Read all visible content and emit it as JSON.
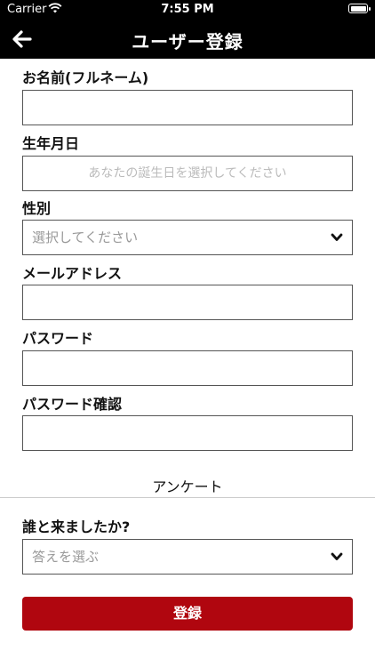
{
  "status_bar": {
    "carrier": "Carrier",
    "time": "7:55 PM"
  },
  "nav": {
    "title": "ユーザー登録",
    "back_icon": "arrow-left-icon"
  },
  "form": {
    "full_name": {
      "label": "お名前(フルネーム)",
      "value": ""
    },
    "birthday": {
      "label": "生年月日",
      "placeholder": "あなたの誕生日を選択してください"
    },
    "gender": {
      "label": "性別",
      "selected": "選択してください"
    },
    "email": {
      "label": "メールアドレス",
      "value": ""
    },
    "password": {
      "label": "パスワード",
      "value": ""
    },
    "password_confirm": {
      "label": "パスワード確認",
      "value": ""
    }
  },
  "survey": {
    "title": "アンケート",
    "question": {
      "label": "誰と来ましたか?",
      "selected": "答えを選ぶ"
    }
  },
  "submit_label": "登録",
  "colors": {
    "header_bg": "#000000",
    "accent": "#b0060f"
  }
}
